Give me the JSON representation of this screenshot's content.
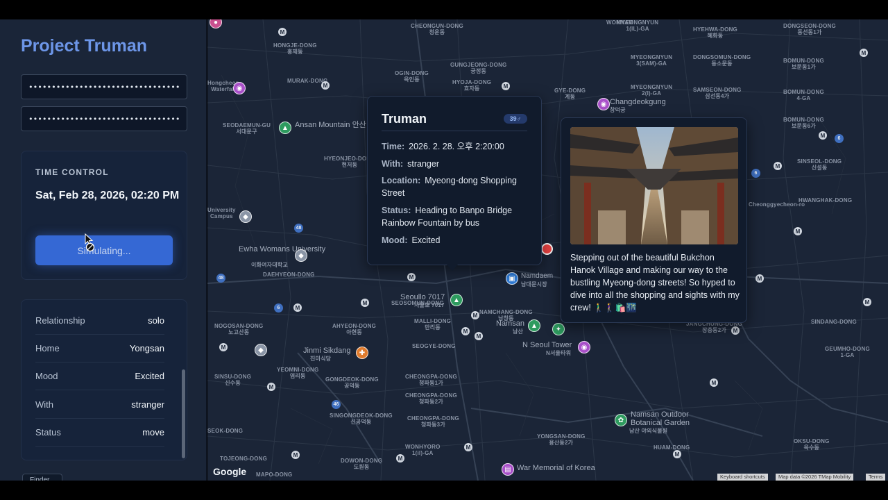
{
  "app": {
    "title": "Project Truman"
  },
  "auth": {
    "field1_value": "••••••••••••••••••••••••••••••••••••••••",
    "field2_value": "••••••••••••••••••••••••••••••••••••••••"
  },
  "time_control": {
    "label": "TIME CONTROL",
    "datetime": "Sat, Feb 28, 2026, 02:20 PM",
    "button_label": "Simulating..."
  },
  "info": [
    {
      "key": "Relationship",
      "value": "solo"
    },
    {
      "key": "Home",
      "value": "Yongsan"
    },
    {
      "key": "Mood",
      "value": "Excited"
    },
    {
      "key": "With",
      "value": "stranger"
    },
    {
      "key": "Status",
      "value": "move"
    }
  ],
  "finder_tab": "Finder",
  "popup": {
    "name": "Truman",
    "badge": "39♂",
    "time_label": "Time:",
    "time": "2026. 2. 28. 오후 2:20:00",
    "with_label": "With:",
    "with": "stranger",
    "location_label": "Location:",
    "location": "Myeong-dong Shopping Street",
    "status_label": "Status:",
    "status": "Heading to Banpo Bridge Rainbow Fountain by bus",
    "mood_label": "Mood:",
    "mood": "Excited"
  },
  "post": {
    "text": "Stepping out of the beautiful Bukchon Hanok Village and making our way to the bustling Myeong-dong streets! So hyped to dive into all the shopping and sights with my crew! 🚶‍♂️🚶‍♀️🛍️🌃"
  },
  "map": {
    "places": [
      {
        "name": "Ansan Mountain",
        "ko": "안산"
      },
      {
        "name": "Ewha Womans University",
        "ko": "이화여자대학교"
      },
      {
        "name": "Changdeokgung",
        "ko": "창덕궁"
      },
      {
        "name": "Seoullo 7017",
        "ko": "서울로 7017"
      },
      {
        "name": "Namsan",
        "ko": "남산"
      },
      {
        "name": "N Seoul Tower",
        "ko": "N서울타워"
      },
      {
        "name": "Jinmi Sikdang",
        "ko": "진미식당"
      },
      {
        "name": "Namsan Outdoor Botanical Garden",
        "ko": "남산 야외식물원"
      },
      {
        "name": "War Memorial of Korea",
        "ko": ""
      },
      {
        "name": "Namdaemun Market",
        "ko": "남대문시장"
      }
    ],
    "google": "Google",
    "keyboard": "Keyboard shortcuts",
    "mapdata": "Map data ©2026 TMap Mobility",
    "terms": "Terms"
  },
  "colors": {
    "accent": "#6d96e8",
    "button": "#3568d4",
    "marker": "#ef4444",
    "map_bg": "#1b2537",
    "sidebar_bg": "#1a2538"
  }
}
